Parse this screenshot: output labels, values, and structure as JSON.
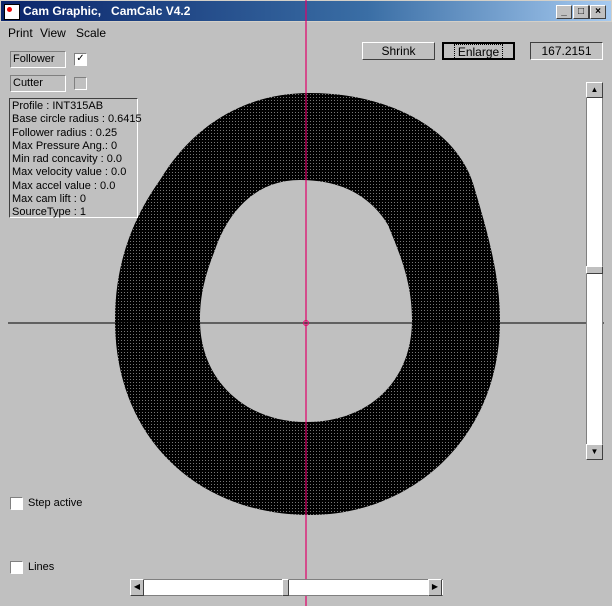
{
  "window": {
    "title": "Cam Graphic,   CamCalc V4.2",
    "controls": [
      "_",
      "□",
      "×"
    ]
  },
  "menu": [
    {
      "label": "Print",
      "accel": "P"
    },
    {
      "label": "View",
      "accel": "V"
    },
    {
      "label": "Scale",
      "accel": "S"
    }
  ],
  "toggles": {
    "follower": {
      "label": "Follower",
      "checked": true,
      "mark": "✓"
    },
    "cutter": {
      "label": "Cutter",
      "checked": false
    }
  },
  "info": [
    "Profile : INT315AB",
    "Base circle radius : 0.6415",
    "Follower radius : 0.25",
    "Max Pressure Ang.: 0",
    "Min rad concavity : 0.0",
    "Max velocity value : 0.0",
    "Max accel value : 0.0",
    "Max cam lift : 0",
    "SourceType : 1"
  ],
  "toolbar": {
    "shrink": "Shrink",
    "enlarge": "Enlarge",
    "scale_value": "167.2151"
  },
  "options": {
    "step_active": {
      "label": "Step active",
      "checked": false
    },
    "lines": {
      "label": "Lines",
      "checked": false
    }
  },
  "scrollbars": {
    "vertical_position": 0.5,
    "horizontal_position": 0.5
  },
  "colors": {
    "axis_vertical": "#e0006a",
    "axis_horizontal": "#000000",
    "cam": "#000000",
    "title_bar": "#0a246a"
  }
}
